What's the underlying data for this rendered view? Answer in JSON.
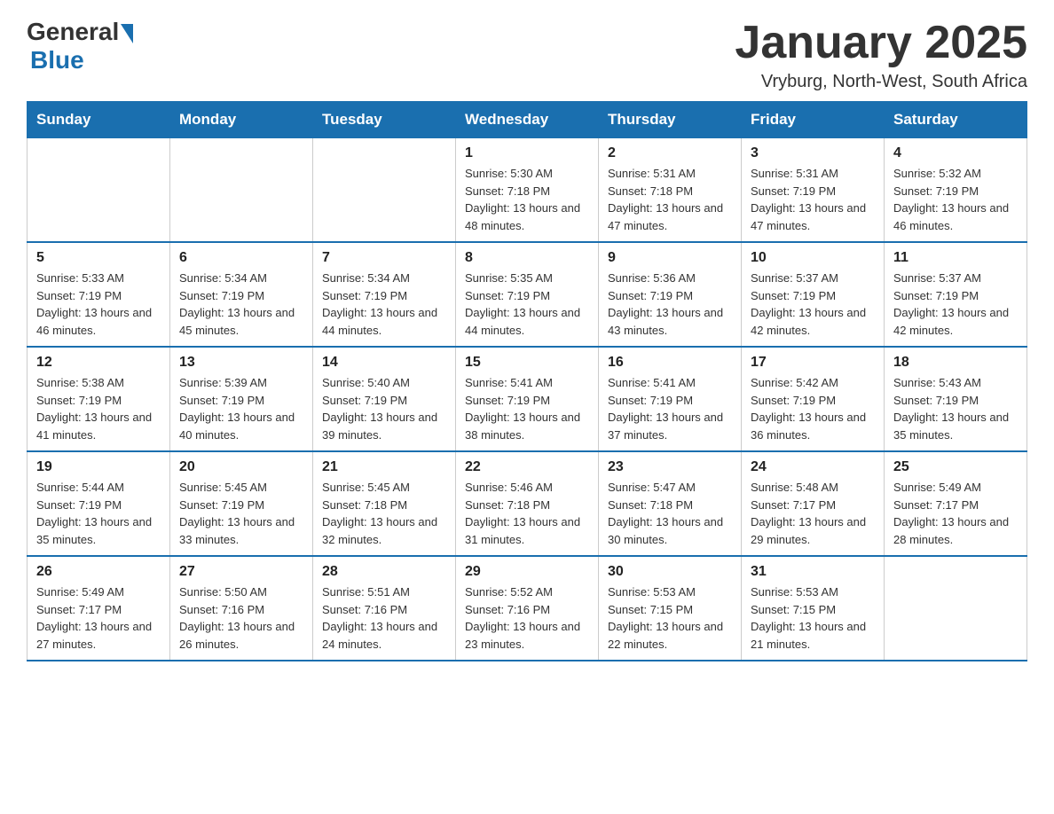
{
  "header": {
    "logo_general": "General",
    "logo_blue": "Blue",
    "title": "January 2025",
    "subtitle": "Vryburg, North-West, South Africa"
  },
  "weekdays": [
    "Sunday",
    "Monday",
    "Tuesday",
    "Wednesday",
    "Thursday",
    "Friday",
    "Saturday"
  ],
  "weeks": [
    [
      {
        "day": "",
        "info": ""
      },
      {
        "day": "",
        "info": ""
      },
      {
        "day": "",
        "info": ""
      },
      {
        "day": "1",
        "info": "Sunrise: 5:30 AM\nSunset: 7:18 PM\nDaylight: 13 hours and 48 minutes."
      },
      {
        "day": "2",
        "info": "Sunrise: 5:31 AM\nSunset: 7:18 PM\nDaylight: 13 hours and 47 minutes."
      },
      {
        "day": "3",
        "info": "Sunrise: 5:31 AM\nSunset: 7:19 PM\nDaylight: 13 hours and 47 minutes."
      },
      {
        "day": "4",
        "info": "Sunrise: 5:32 AM\nSunset: 7:19 PM\nDaylight: 13 hours and 46 minutes."
      }
    ],
    [
      {
        "day": "5",
        "info": "Sunrise: 5:33 AM\nSunset: 7:19 PM\nDaylight: 13 hours and 46 minutes."
      },
      {
        "day": "6",
        "info": "Sunrise: 5:34 AM\nSunset: 7:19 PM\nDaylight: 13 hours and 45 minutes."
      },
      {
        "day": "7",
        "info": "Sunrise: 5:34 AM\nSunset: 7:19 PM\nDaylight: 13 hours and 44 minutes."
      },
      {
        "day": "8",
        "info": "Sunrise: 5:35 AM\nSunset: 7:19 PM\nDaylight: 13 hours and 44 minutes."
      },
      {
        "day": "9",
        "info": "Sunrise: 5:36 AM\nSunset: 7:19 PM\nDaylight: 13 hours and 43 minutes."
      },
      {
        "day": "10",
        "info": "Sunrise: 5:37 AM\nSunset: 7:19 PM\nDaylight: 13 hours and 42 minutes."
      },
      {
        "day": "11",
        "info": "Sunrise: 5:37 AM\nSunset: 7:19 PM\nDaylight: 13 hours and 42 minutes."
      }
    ],
    [
      {
        "day": "12",
        "info": "Sunrise: 5:38 AM\nSunset: 7:19 PM\nDaylight: 13 hours and 41 minutes."
      },
      {
        "day": "13",
        "info": "Sunrise: 5:39 AM\nSunset: 7:19 PM\nDaylight: 13 hours and 40 minutes."
      },
      {
        "day": "14",
        "info": "Sunrise: 5:40 AM\nSunset: 7:19 PM\nDaylight: 13 hours and 39 minutes."
      },
      {
        "day": "15",
        "info": "Sunrise: 5:41 AM\nSunset: 7:19 PM\nDaylight: 13 hours and 38 minutes."
      },
      {
        "day": "16",
        "info": "Sunrise: 5:41 AM\nSunset: 7:19 PM\nDaylight: 13 hours and 37 minutes."
      },
      {
        "day": "17",
        "info": "Sunrise: 5:42 AM\nSunset: 7:19 PM\nDaylight: 13 hours and 36 minutes."
      },
      {
        "day": "18",
        "info": "Sunrise: 5:43 AM\nSunset: 7:19 PM\nDaylight: 13 hours and 35 minutes."
      }
    ],
    [
      {
        "day": "19",
        "info": "Sunrise: 5:44 AM\nSunset: 7:19 PM\nDaylight: 13 hours and 35 minutes."
      },
      {
        "day": "20",
        "info": "Sunrise: 5:45 AM\nSunset: 7:19 PM\nDaylight: 13 hours and 33 minutes."
      },
      {
        "day": "21",
        "info": "Sunrise: 5:45 AM\nSunset: 7:18 PM\nDaylight: 13 hours and 32 minutes."
      },
      {
        "day": "22",
        "info": "Sunrise: 5:46 AM\nSunset: 7:18 PM\nDaylight: 13 hours and 31 minutes."
      },
      {
        "day": "23",
        "info": "Sunrise: 5:47 AM\nSunset: 7:18 PM\nDaylight: 13 hours and 30 minutes."
      },
      {
        "day": "24",
        "info": "Sunrise: 5:48 AM\nSunset: 7:17 PM\nDaylight: 13 hours and 29 minutes."
      },
      {
        "day": "25",
        "info": "Sunrise: 5:49 AM\nSunset: 7:17 PM\nDaylight: 13 hours and 28 minutes."
      }
    ],
    [
      {
        "day": "26",
        "info": "Sunrise: 5:49 AM\nSunset: 7:17 PM\nDaylight: 13 hours and 27 minutes."
      },
      {
        "day": "27",
        "info": "Sunrise: 5:50 AM\nSunset: 7:16 PM\nDaylight: 13 hours and 26 minutes."
      },
      {
        "day": "28",
        "info": "Sunrise: 5:51 AM\nSunset: 7:16 PM\nDaylight: 13 hours and 24 minutes."
      },
      {
        "day": "29",
        "info": "Sunrise: 5:52 AM\nSunset: 7:16 PM\nDaylight: 13 hours and 23 minutes."
      },
      {
        "day": "30",
        "info": "Sunrise: 5:53 AM\nSunset: 7:15 PM\nDaylight: 13 hours and 22 minutes."
      },
      {
        "day": "31",
        "info": "Sunrise: 5:53 AM\nSunset: 7:15 PM\nDaylight: 13 hours and 21 minutes."
      },
      {
        "day": "",
        "info": ""
      }
    ]
  ]
}
